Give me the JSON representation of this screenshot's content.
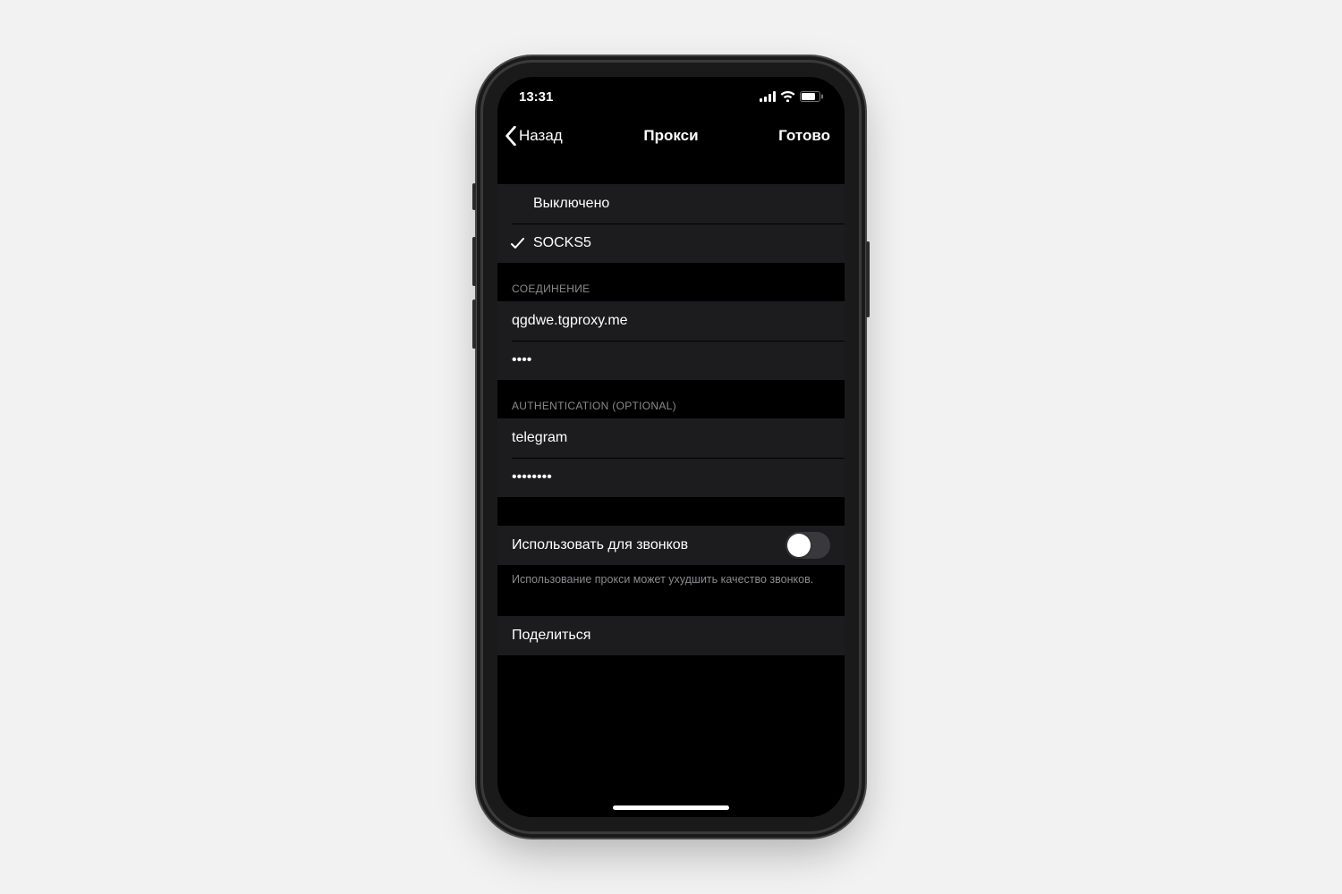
{
  "status": {
    "time": "13:31"
  },
  "nav": {
    "back": "Назад",
    "title": "Прокси",
    "done": "Готово"
  },
  "proxy_type": {
    "disabled": "Выключено",
    "socks5": "SOCKS5",
    "selected": "socks5"
  },
  "connection": {
    "header": "СОЕДИНЕНИЕ",
    "server": "qgdwe.tgproxy.me",
    "port_masked": "••••"
  },
  "auth": {
    "header": "AUTHENTICATION (OPTIONAL)",
    "username": "telegram",
    "password_masked": "••••••••"
  },
  "calls": {
    "label": "Использовать для звонков",
    "enabled": false,
    "note": "Использование прокси может ухудшить качество звонков."
  },
  "share": {
    "label": "Поделиться"
  }
}
